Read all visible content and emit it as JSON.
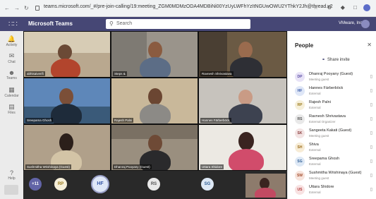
{
  "browser": {
    "url": "teams.microsoft.com/_#/pre-join-calling/19:meeting_ZGM0MDMzODA4MDBiNi00YzUyLWFhYzItNGUwOWU2YThkY2Jh@thread.v2"
  },
  "header": {
    "brand": "Microsoft Teams",
    "search_placeholder": "Search",
    "org": "VMware, Inc."
  },
  "rail": [
    {
      "icon": "activity-icon",
      "label": "Activity"
    },
    {
      "icon": "chat-icon",
      "label": "Chat"
    },
    {
      "icon": "teams-icon",
      "label": "Teams"
    },
    {
      "icon": "calendar-icon",
      "label": "Calendar"
    },
    {
      "icon": "files-icon",
      "label": "Files"
    },
    {
      "icon": "help-icon",
      "label": "Help"
    }
  ],
  "tiles": [
    {
      "name": "abhisaiverifi"
    },
    {
      "name": "Steps & "
    },
    {
      "name": "Ravnesh Shrivastava"
    },
    {
      "name": "Sreepama Ghosh"
    },
    {
      "name": "Rajesh Palni"
    },
    {
      "name": "Hannes Färberböck"
    },
    {
      "name": "Sushmitha Wrishinaya (Guest)"
    },
    {
      "name": "Dhanraj Pooyany (Guest)"
    },
    {
      "name": "Uttara Shidore"
    }
  ],
  "bottom_avatars": [
    "+11",
    "RP",
    "HF",
    "RS",
    "SG"
  ],
  "people_panel": {
    "title": "People",
    "share_invite": "Share invite",
    "participants": [
      {
        "initials": "DP",
        "name": "Dhanraj Pooyany (Guest)",
        "status": "Meeting guest",
        "color": "#e8e3f7",
        "fg": "#5b4da3"
      },
      {
        "initials": "HF",
        "name": "Hannes Färberböck",
        "status": "External",
        "color": "#dfe7f7",
        "fg": "#3a5aa8"
      },
      {
        "initials": "RP",
        "name": "Rajesh Palni",
        "status": "External",
        "color": "#f6efd9",
        "fg": "#9b7a1b"
      },
      {
        "initials": "RS",
        "name": "Ravnesh Shrivastava",
        "status": "External  Organizer",
        "color": "#e9e9e9",
        "fg": "#555555"
      },
      {
        "initials": "SK",
        "name": "Sangeeta Kakati (Guest)",
        "status": "Meeting guest",
        "color": "#f3e4e4",
        "fg": "#8a3b3b"
      },
      {
        "initials": "SH",
        "name": "Shiva",
        "status": "External",
        "color": "#f7ecd6",
        "fg": "#9a6a17"
      },
      {
        "initials": "SG",
        "name": "Sreepama Ghosh",
        "status": "External",
        "color": "#dde8f5",
        "fg": "#2f5e95"
      },
      {
        "initials": "SW",
        "name": "Sushmitha Wrishinaya (Guest)",
        "status": "Meeting guest",
        "color": "#f7e4dc",
        "fg": "#a24b2c"
      },
      {
        "initials": "US",
        "name": "Uttara Shidore",
        "status": "External",
        "color": "#f8e2e2",
        "fg": "#b03838"
      }
    ]
  }
}
